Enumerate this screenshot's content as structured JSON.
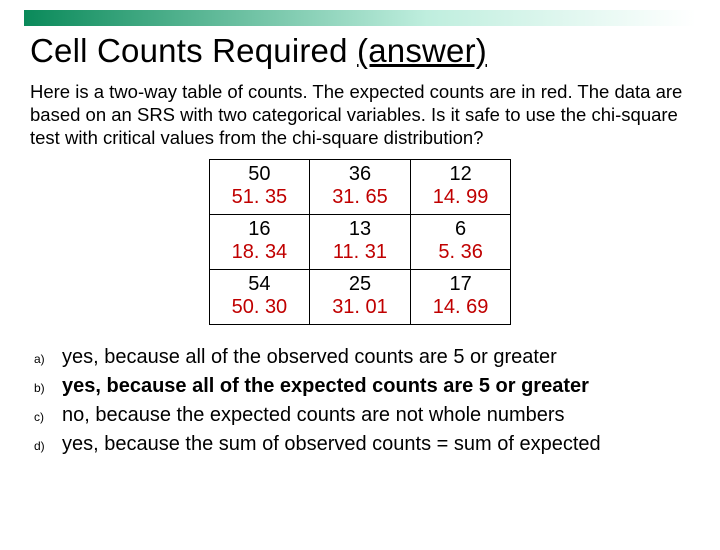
{
  "title_main": "Cell Counts Required ",
  "title_paren": "(answer)",
  "intro": "Here is a two-way table of counts. The expected counts are in red. The data are based on an SRS with two categorical variables.  Is it safe to use the chi-square test with critical values from the chi-square distribution?",
  "table": {
    "rows": [
      [
        {
          "obs": "50",
          "exp": "51. 35"
        },
        {
          "obs": "36",
          "exp": "31. 65"
        },
        {
          "obs": "12",
          "exp": "14. 99"
        }
      ],
      [
        {
          "obs": "16",
          "exp": "18. 34"
        },
        {
          "obs": "13",
          "exp": "11. 31"
        },
        {
          "obs": "6",
          "exp": "5. 36"
        }
      ],
      [
        {
          "obs": "54",
          "exp": "50. 30"
        },
        {
          "obs": "25",
          "exp": "31. 01"
        },
        {
          "obs": "17",
          "exp": "14. 69"
        }
      ]
    ]
  },
  "options": [
    {
      "marker": "a)",
      "text": "yes, because all of the observed counts are 5 or greater",
      "correct": false
    },
    {
      "marker": "b)",
      "text": "yes, because all of the expected counts are 5 or greater",
      "correct": true
    },
    {
      "marker": "c)",
      "text": "no, because the expected counts are not whole numbers",
      "correct": false
    },
    {
      "marker": "d)",
      "text": "yes, because the sum of observed counts = sum of  expected",
      "correct": false
    }
  ],
  "chart_data": {
    "type": "table",
    "title": "Two-way table of observed and expected counts",
    "rows": 3,
    "cols": 3,
    "observed": [
      [
        50,
        36,
        12
      ],
      [
        16,
        13,
        6
      ],
      [
        54,
        25,
        17
      ]
    ],
    "expected": [
      [
        51.35,
        31.65,
        14.99
      ],
      [
        18.34,
        11.31,
        5.36
      ],
      [
        50.3,
        31.01,
        14.69
      ]
    ]
  }
}
